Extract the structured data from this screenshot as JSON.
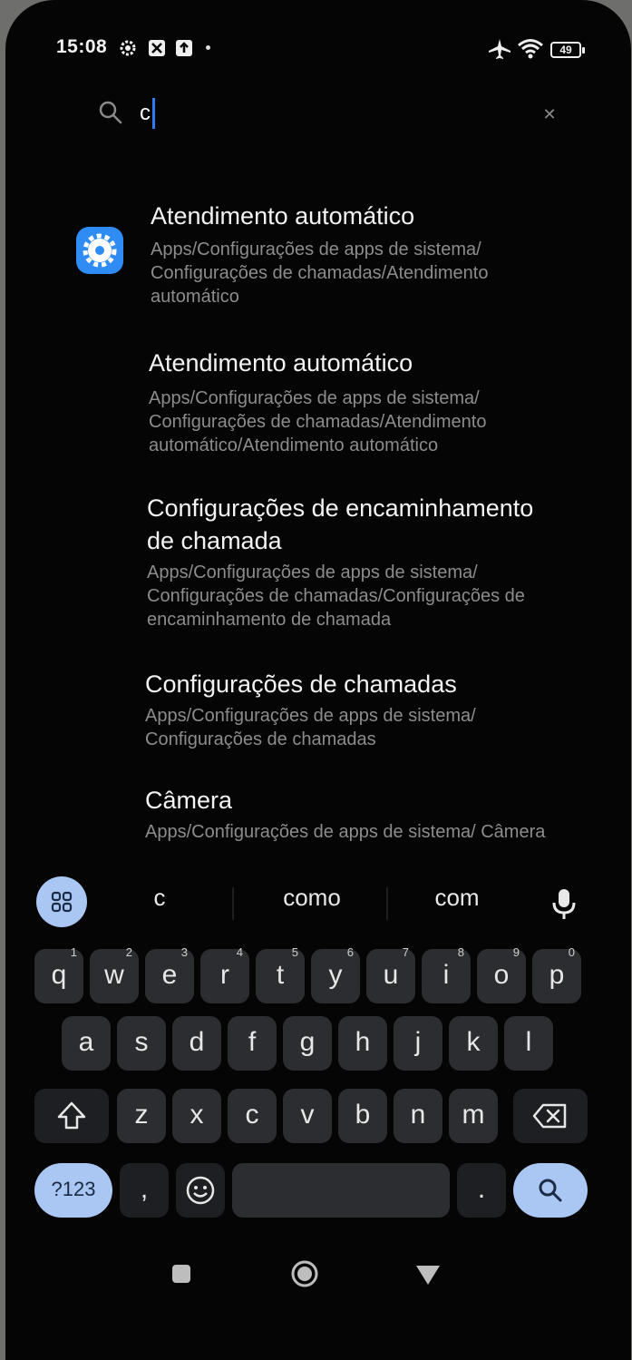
{
  "status_bar": {
    "time": "15:08",
    "battery": "49",
    "icons": [
      "settings-gear-icon",
      "android-face-icon",
      "notification-app-icon",
      "dot-icon",
      "airplane-icon",
      "wifi-icon",
      "battery-icon"
    ]
  },
  "search": {
    "value": "c",
    "icon": "search-icon",
    "clear_icon": "close-icon"
  },
  "results": [
    {
      "title": "Atendimento automático",
      "path": "Apps/Configurações de apps de sistema/ Configurações de chamadas/Atendimento automático",
      "icon": "settings-gear-icon"
    },
    {
      "title": "Atendimento automático",
      "path": "Apps/Configurações de apps de sistema/ Configurações de chamadas/Atendimento automático/Atendimento automático"
    },
    {
      "title": "Configurações de encaminhamento de chamada",
      "path": "Apps/Configurações de apps de sistema/ Configurações de chamadas/Configurações de encaminhamento de chamada"
    },
    {
      "title": "Configurações de chamadas",
      "path": "Apps/Configurações de apps de sistema/ Configurações de chamadas"
    },
    {
      "title": "Câmera",
      "path": "Apps/Configurações de apps de sistema/ Câmera"
    }
  ],
  "suggestions": [
    "c",
    "como",
    "com"
  ],
  "keyboard": {
    "row1": [
      {
        "key": "q",
        "num": "1"
      },
      {
        "key": "w",
        "num": "2"
      },
      {
        "key": "e",
        "num": "3"
      },
      {
        "key": "r",
        "num": "4"
      },
      {
        "key": "t",
        "num": "5"
      },
      {
        "key": "y",
        "num": "6"
      },
      {
        "key": "u",
        "num": "7"
      },
      {
        "key": "i",
        "num": "8"
      },
      {
        "key": "o",
        "num": "9"
      },
      {
        "key": "p",
        "num": "0"
      }
    ],
    "row2": [
      "a",
      "s",
      "d",
      "f",
      "g",
      "h",
      "j",
      "k",
      "l"
    ],
    "row3": [
      "z",
      "x",
      "c",
      "v",
      "b",
      "n",
      "m"
    ],
    "symbols_label": "?123",
    "comma": ",",
    "period": ".",
    "icons": [
      "shift-icon",
      "backspace-icon",
      "emoji-icon",
      "search-icon"
    ]
  },
  "navbar": {
    "icons": [
      "recents-square-icon",
      "home-circle-icon",
      "back-triangle-icon"
    ]
  },
  "colors": {
    "accent": "#2f7cf6",
    "background": "#050505",
    "key": "#2c2d31",
    "key_accent": "#a9c7f2",
    "secondary_text": "#8c8c8c"
  }
}
